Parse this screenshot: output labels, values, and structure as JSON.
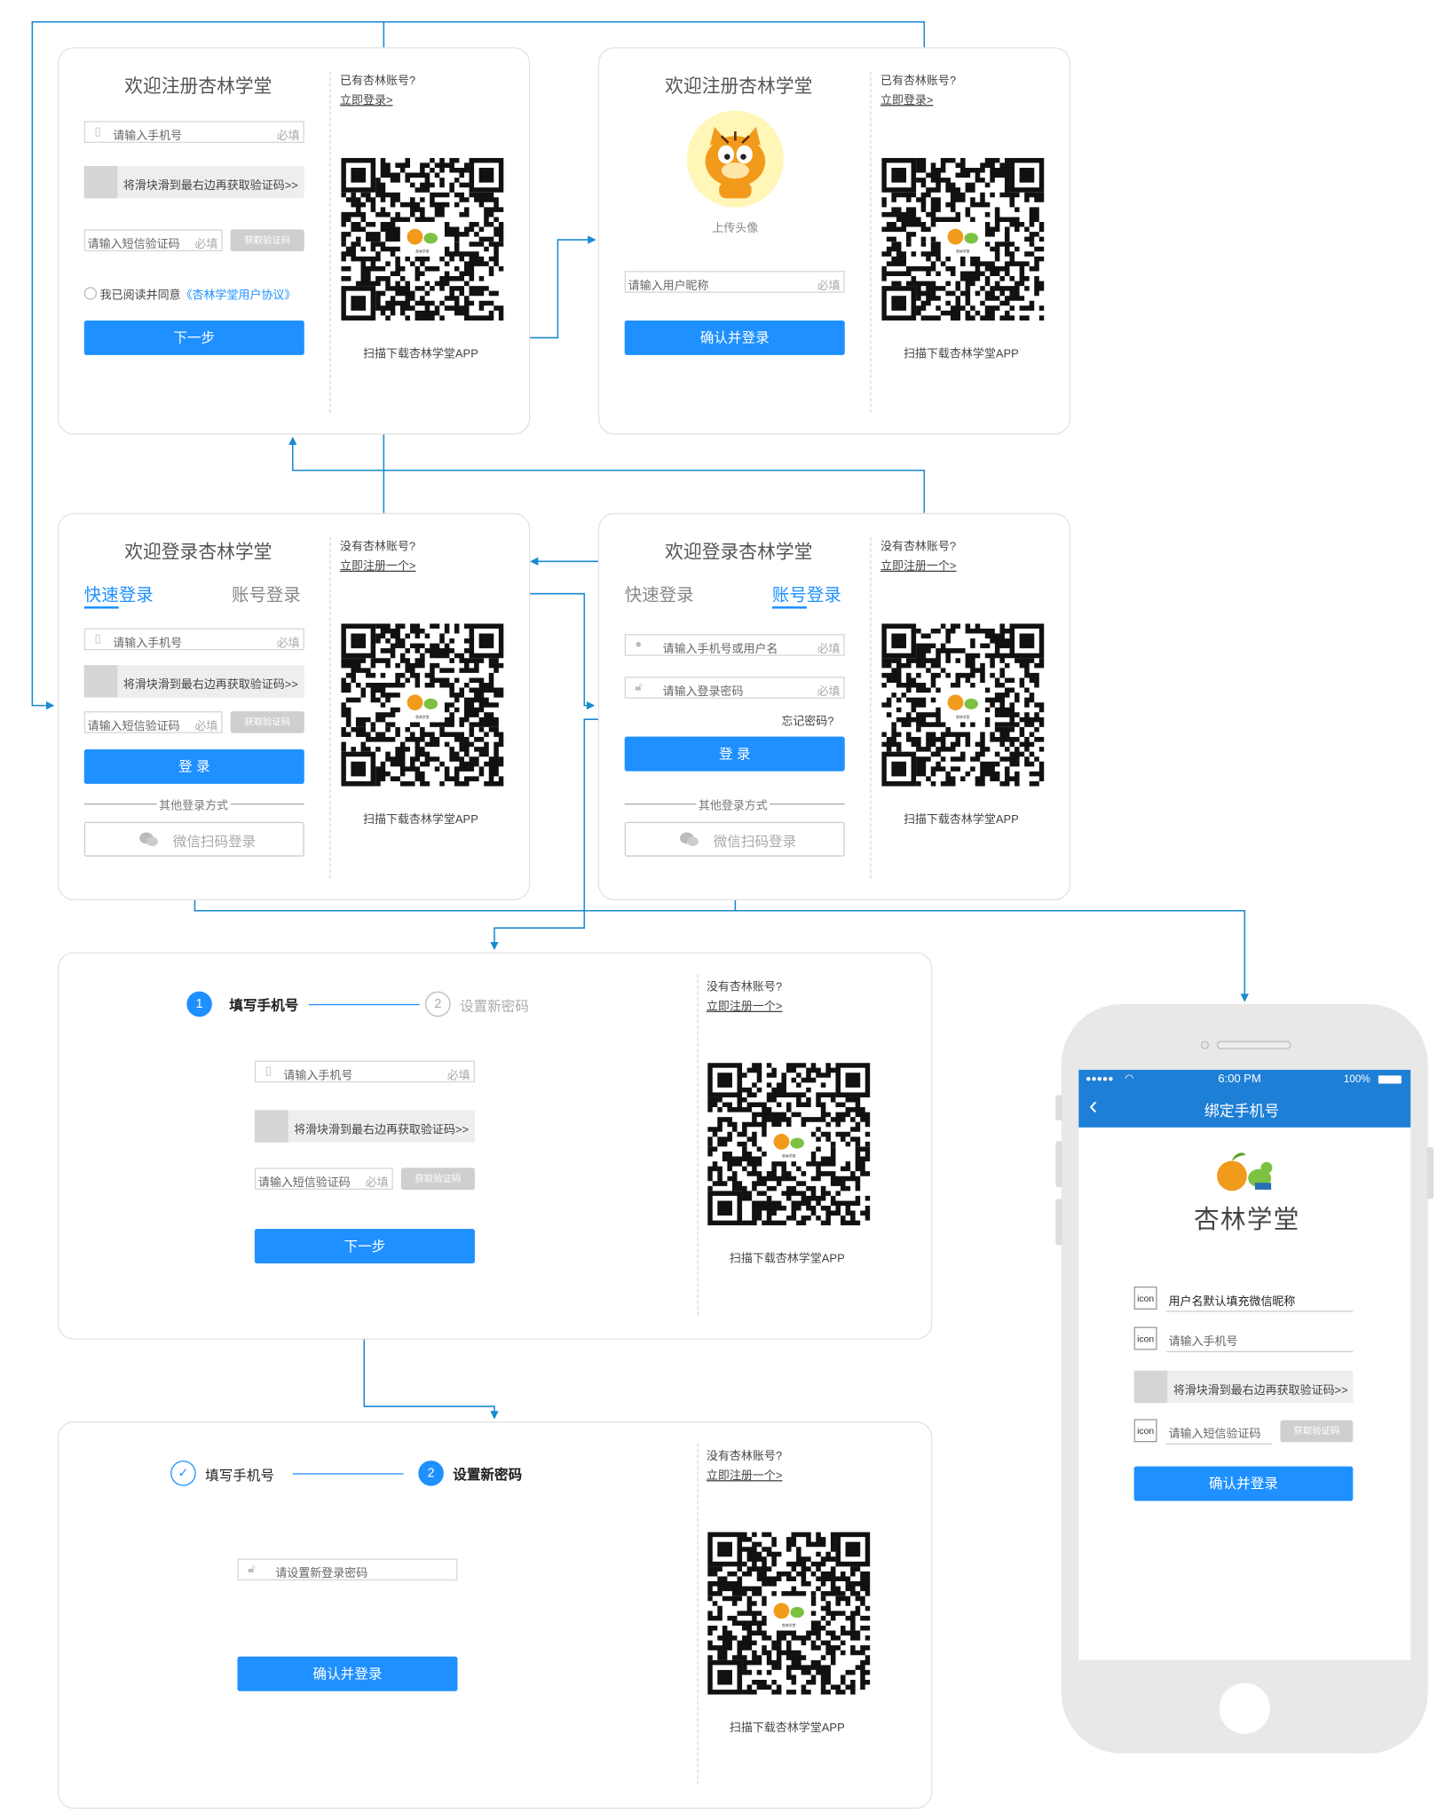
{
  "register": {
    "title": "欢迎注册杏林学堂",
    "have_account": "已有杏林账号?",
    "login_link": "立即登录>",
    "phone_placeholder": "请输入手机号",
    "required": "必填",
    "slider_text": "将滑块滑到最右边再获取验证码>>",
    "sms_placeholder": "请输入短信验证码",
    "get_code": "获取验证码",
    "agree_prefix": "我已阅读并同意",
    "agreement": "《杏林学堂用户协议》",
    "next": "下一步",
    "qr_caption": "扫描下载杏林学堂APP"
  },
  "register2": {
    "title": "欢迎注册杏林学堂",
    "have_account": "已有杏林账号?",
    "login_link": "立即登录>",
    "upload_avatar": "上传头像",
    "nickname_placeholder": "请输入用户昵称",
    "required": "必填",
    "confirm": "确认并登录",
    "qr_caption": "扫描下载杏林学堂APP"
  },
  "login_quick": {
    "title": "欢迎登录杏林学堂",
    "no_account": "没有杏林账号?",
    "register_link": "立即注册一个>",
    "tab_quick": "快速登录",
    "tab_account": "账号登录",
    "phone_placeholder": "请输入手机号",
    "required": "必填",
    "slider_text": "将滑块滑到最右边再获取验证码>>",
    "sms_placeholder": "请输入短信验证码",
    "get_code": "获取验证码",
    "login": "登 录",
    "other_login": "其他登录方式",
    "wechat": "微信扫码登录",
    "qr_caption": "扫描下载杏林学堂APP"
  },
  "login_account": {
    "title": "欢迎登录杏林学堂",
    "no_account": "没有杏林账号?",
    "register_link": "立即注册一个>",
    "tab_quick": "快速登录",
    "tab_account": "账号登录",
    "user_placeholder": "请输入手机号或用户名",
    "pwd_placeholder": "请输入登录密码",
    "required": "必填",
    "forgot": "忘记密码?",
    "login": "登 录",
    "other_login": "其他登录方式",
    "wechat": "微信扫码登录",
    "qr_caption": "扫描下载杏林学堂APP"
  },
  "reset1": {
    "step1_num": "1",
    "step1": "填写手机号",
    "step2_num": "2",
    "step2": "设置新密码",
    "no_account": "没有杏林账号?",
    "register_link": "立即注册一个>",
    "phone_placeholder": "请输入手机号",
    "required": "必填",
    "slider_text": "将滑块滑到最右边再获取验证码>>",
    "sms_placeholder": "请输入短信验证码",
    "get_code": "获取验证码",
    "next": "下一步",
    "qr_caption": "扫描下载杏林学堂APP"
  },
  "reset2": {
    "step1_num": "✓",
    "step1": "填写手机号",
    "step2_num": "2",
    "step2": "设置新密码",
    "no_account": "没有杏林账号?",
    "register_link": "立即注册一个>",
    "pwd_placeholder": "请设置新登录密码",
    "confirm": "确认并登录",
    "qr_caption": "扫描下载杏林学堂APP"
  },
  "phone": {
    "carrier": "●●●●● ",
    "time": "6:00 PM",
    "battery": "100%",
    "nav_title": "绑定手机号",
    "back": "‹",
    "brand": "杏林学堂",
    "icon_label": "icon",
    "nickname_hint": "用户名默认填充微信昵称",
    "phone_placeholder": "请输入手机号",
    "slider_text": "将滑块滑到最右边再获取验证码>>",
    "sms_placeholder": "请输入短信验证码",
    "get_code": "获取验证码",
    "confirm": "确认并登录"
  },
  "qr_logo": "杏林学堂",
  "colors": {
    "accent": "#1e90ff",
    "nav": "#1e7fd6",
    "connector": "#1a8ad0"
  }
}
